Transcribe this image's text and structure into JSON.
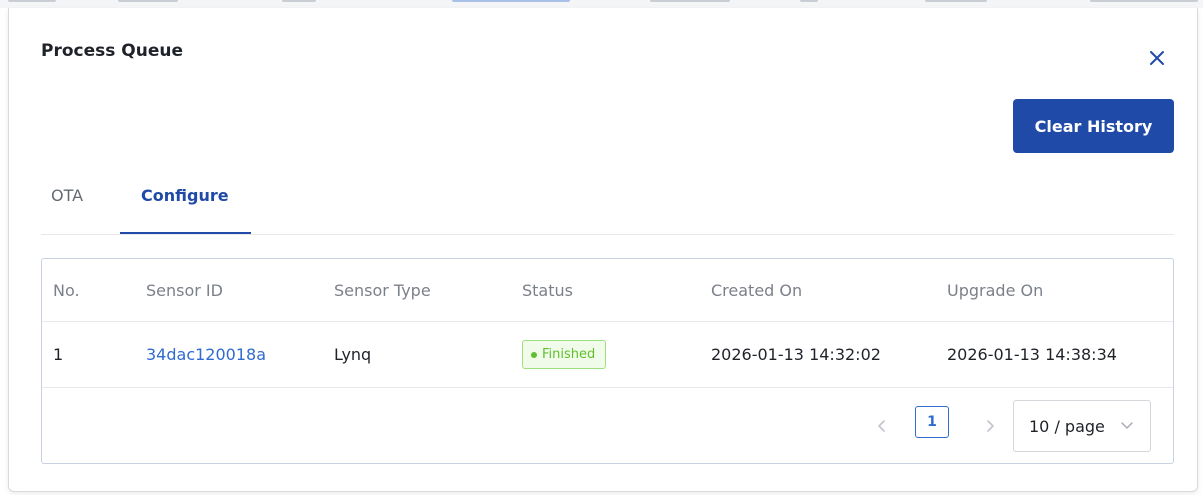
{
  "colors": {
    "primary": "#1f4aa8",
    "link": "#2f6bd0",
    "success": "#5fbf2c",
    "success_bg": "#f1fbea"
  },
  "modal": {
    "title": "Process Queue",
    "close_icon": "close-icon",
    "clear_history_label": "Clear History"
  },
  "tabs": [
    {
      "label": "OTA",
      "active": false
    },
    {
      "label": "Configure",
      "active": true
    }
  ],
  "table": {
    "columns": [
      "No.",
      "Sensor ID",
      "Sensor Type",
      "Status",
      "Created On",
      "Upgrade On"
    ],
    "rows": [
      {
        "no": "1",
        "sensor_id": "34dac120018a",
        "sensor_type": "Lynq",
        "status": "Finished",
        "created_on": "2026-01-13 14:32:02",
        "upgrade_on": "2026-01-13 14:38:34"
      }
    ]
  },
  "pagination": {
    "prev_icon": "chevron-left-icon",
    "next_icon": "chevron-right-icon",
    "current_page": "1",
    "page_size": "10 / page",
    "page_size_icon": "chevron-down-icon"
  }
}
